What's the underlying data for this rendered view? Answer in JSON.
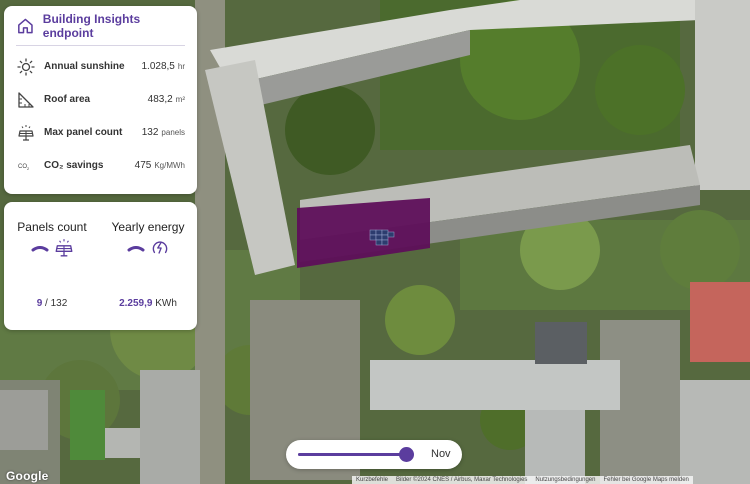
{
  "insights": {
    "title": "Building Insights endpoint",
    "rows": [
      {
        "icon": "sun-icon",
        "label": "Annual sunshine",
        "value": "1.028,5",
        "unit": "hr"
      },
      {
        "icon": "roof-area-icon",
        "label": "Roof area",
        "value": "483,2",
        "unit": "m²"
      },
      {
        "icon": "solar-panel-icon",
        "label": "Max panel count",
        "value": "132",
        "unit": "panels"
      },
      {
        "icon": "co2-icon",
        "label": "CO₂ savings",
        "value": "475",
        "unit": "Kg/MWh"
      }
    ]
  },
  "energy": {
    "panels": {
      "title": "Panels count",
      "current": "9",
      "max": "/ 132"
    },
    "yearly": {
      "title": "Yearly energy",
      "value": "2.259,9",
      "unit": "KWh"
    }
  },
  "slider": {
    "month": "Nov",
    "progress": 0.93
  },
  "map": {
    "logo": "Google",
    "attribution": [
      "Kurzbefehle",
      "Bilder ©2024 CNES / Airbus, Maxar Technologies",
      "Nutzungsbedingungen",
      "Fehler bei Google Maps melden"
    ]
  },
  "colors": {
    "accent": "#5b3d9e",
    "roof_overlay": "#5e0f5a"
  }
}
